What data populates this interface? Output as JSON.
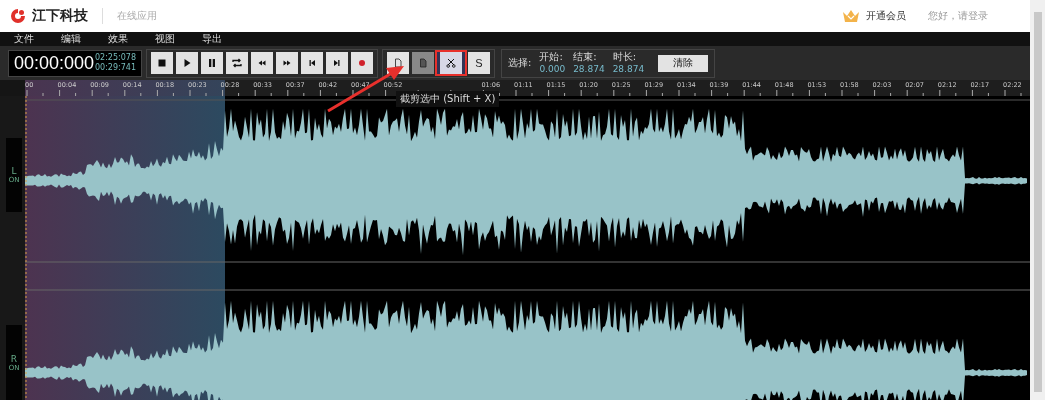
{
  "header": {
    "brand": "江下科技",
    "app_label": "在线应用",
    "vip": "开通会员",
    "login": "您好，请登录"
  },
  "menu": [
    "文件",
    "编辑",
    "效果",
    "视图",
    "导出"
  ],
  "timer": {
    "current": "00:00:000",
    "total": "02:25:078",
    "selection": "00:29:741"
  },
  "transport": [
    {
      "kind": "stop"
    },
    {
      "kind": "play"
    },
    {
      "kind": "pause"
    },
    {
      "kind": "loop"
    },
    {
      "kind": "rewind"
    },
    {
      "kind": "forward"
    },
    {
      "kind": "start"
    },
    {
      "kind": "end"
    },
    {
      "kind": "record"
    }
  ],
  "edit_tools": [
    {
      "kind": "copy",
      "selected": false,
      "disabled": false
    },
    {
      "kind": "paste",
      "selected": false,
      "disabled": true
    },
    {
      "kind": "cut",
      "selected": true,
      "disabled": false
    },
    {
      "kind": "silence",
      "label": "S",
      "selected": false,
      "disabled": false
    }
  ],
  "tooltip": "截剪选中 (Shift + X)",
  "selection": {
    "label": "选择:",
    "start_label": "开始:",
    "start": "0.000",
    "end_label": "结束:",
    "end": "28.874",
    "duration_label": "时长:",
    "duration": "28.874",
    "clear": "清除"
  },
  "ruler": {
    "labels_before": [
      "00",
      "00:04",
      "00:09",
      "00:14",
      "00:18",
      "00:23",
      "00:28",
      "00:33",
      "00:37",
      "00:42",
      "00:47",
      "00:52"
    ],
    "labels_after": [
      "01:06",
      "01:11",
      "01:15",
      "01:20",
      "01:25",
      "01:29",
      "01:34",
      "01:39",
      "01:44",
      "01:48",
      "01:53",
      "01:58",
      "02:03",
      "02:07",
      "02:12",
      "02:17",
      "02:22"
    ]
  },
  "channels": [
    {
      "name": "L",
      "state": "ON"
    },
    {
      "name": "R",
      "state": "ON"
    }
  ]
}
